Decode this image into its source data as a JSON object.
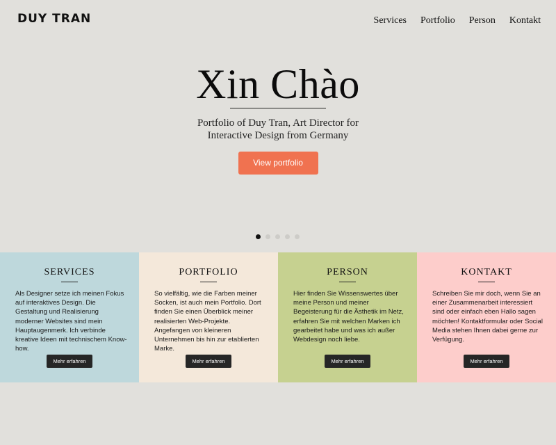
{
  "header": {
    "logo": "DUY TRAN",
    "nav": [
      "Services",
      "Portfolio",
      "Person",
      "Kontakt"
    ]
  },
  "hero": {
    "title": "Xin Chào",
    "subtitle": "Portfolio of Duy Tran, Art Director for Interactive Design from Germany",
    "cta_label": "View portfolio"
  },
  "slider": {
    "count": 5,
    "active": 1
  },
  "panels": [
    {
      "title": "SERVICES",
      "text": "Als Designer setze ich meinen Fokus auf interaktives Design. Die Gestaltung und Realisierung moderner Websites sind mein Hauptaugenmerk. Ich verbinde kreative Ideen mit technischem Know-how.",
      "button": "Mehr erfahren",
      "color": "#bed8dc"
    },
    {
      "title": "PORTFOLIO",
      "text": "So vielfältig, wie die Farben meiner Socken, ist auch mein Portfolio. Dort finden Sie einen Überblick meiner realisierten Web-Projekte. Angefangen von kleineren Unternehmen bis hin zur etablierten Marke.",
      "button": "Mehr erfahren",
      "color": "#f4e8da"
    },
    {
      "title": "PERSON",
      "text": "Hier finden Sie Wissenswertes über meine Person und meiner Begeisterung für die Ästhetik im Netz, erfahren Sie mit welchen Marken ich gearbeitet habe und was ich außer Webdesign noch liebe.",
      "button": "Mehr erfahren",
      "color": "#c6d190"
    },
    {
      "title": "KONTAKT",
      "text": "Schreiben Sie mir doch, wenn Sie an einer Zusammenarbeit interessiert sind oder einfach eben Hallo sagen möchten! Kontaktformular oder Social Media stehen Ihnen dabei gerne zur Verfügung.",
      "button": "Mehr erfahren",
      "color": "#fdcdcb"
    }
  ],
  "colors": {
    "background": "#e1e0dc",
    "accent": "#f07250",
    "button_dark": "#262626"
  }
}
